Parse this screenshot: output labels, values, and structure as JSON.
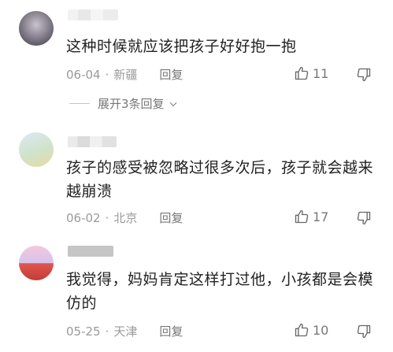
{
  "comments": [
    {
      "text": "这种时候就应该把孩子好好抱一抱",
      "date": "06-04",
      "location": "新疆",
      "reply_label": "回复",
      "likes": "11",
      "thumb_icon": "thumbs-up-icon",
      "dislike_icon": "thumbs-down-icon"
    },
    {
      "text": "孩子的感受被忽略过很多次后，孩子就会越来越崩溃",
      "date": "06-02",
      "location": "北京",
      "reply_label": "回复",
      "likes": "17",
      "thumb_icon": "thumbs-up-icon",
      "dislike_icon": "thumbs-down-icon"
    },
    {
      "text": "我觉得，妈妈肯定这样打过他，小孩都是会模仿的",
      "date": "05-25",
      "location": "天津",
      "reply_label": "回复",
      "likes": "10",
      "thumb_icon": "thumbs-up-icon",
      "dislike_icon": "thumbs-down-icon"
    }
  ],
  "expand_replies": {
    "label": "展开3条回复",
    "icon": "chevron-down-icon"
  },
  "meta_separator": "·"
}
